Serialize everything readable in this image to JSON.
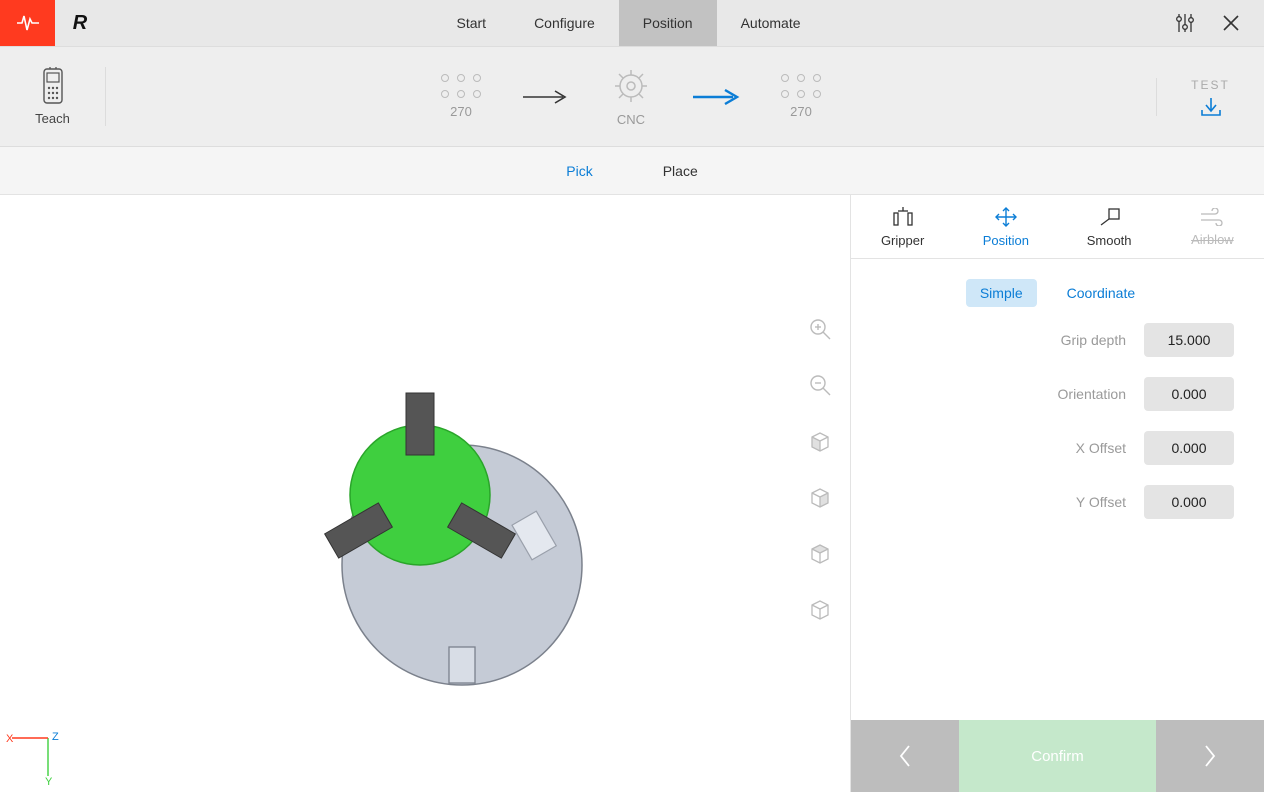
{
  "topbar": {
    "tabs": [
      "Start",
      "Configure",
      "Position",
      "Automate"
    ],
    "active_tab_index": 2
  },
  "workflow": {
    "teach_label": "Teach",
    "nodes": [
      {
        "label": "270",
        "type": "dots"
      },
      {
        "label": "CNC",
        "type": "gear"
      },
      {
        "label": "270",
        "type": "dots"
      }
    ],
    "test_label": "TEST"
  },
  "subtabs": {
    "items": [
      "Pick",
      "Place"
    ],
    "active_index": 0
  },
  "panel": {
    "tabs": [
      {
        "label": "Gripper",
        "state": "normal"
      },
      {
        "label": "Position",
        "state": "active"
      },
      {
        "label": "Smooth",
        "state": "normal"
      },
      {
        "label": "Airblow",
        "state": "disabled"
      }
    ],
    "modes": [
      "Simple",
      "Coordinate"
    ],
    "active_mode_index": 0,
    "fields": [
      {
        "label": "Grip depth",
        "value": "15.000"
      },
      {
        "label": "Orientation",
        "value": "0.000"
      },
      {
        "label": "X Offset",
        "value": "0.000"
      },
      {
        "label": "Y Offset",
        "value": "0.000"
      }
    ],
    "confirm_label": "Confirm"
  },
  "axes": {
    "x": "X",
    "y": "Y",
    "z": "Z"
  }
}
